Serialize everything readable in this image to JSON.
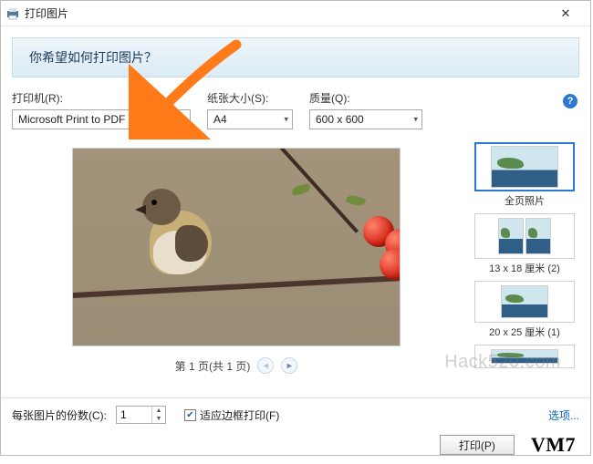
{
  "title": "打印图片",
  "banner": "你希望如何打印图片？",
  "labels": {
    "printer": "打印机(R):",
    "paper": "纸张大小(S):",
    "quality": "质量(Q):"
  },
  "selects": {
    "printer": "Microsoft Print to PDF",
    "paper": "A4",
    "quality": "600 x 600"
  },
  "pager": "第 1 页(共 1 页)",
  "layouts": {
    "full": "全页照片",
    "l2": "13 x 18 厘米 (2)",
    "l3": "20 x 25 厘米 (1)"
  },
  "bottom": {
    "copies_label": "每张图片的份数(C):",
    "copies_value": "1",
    "fit_label": "适应边框打印(F)",
    "options": "选项..."
  },
  "buttons": {
    "print": "打印(P)"
  },
  "watermark": "Hack520.com",
  "brand": "VM7"
}
